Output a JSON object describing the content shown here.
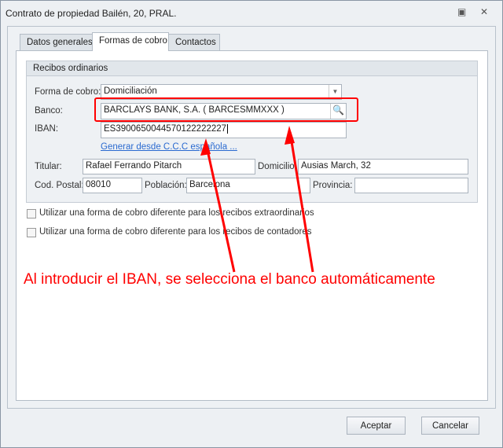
{
  "window": {
    "title": "Contrato de propiedad Bailén, 20, PRAL."
  },
  "tabs": [
    {
      "label": "Datos generales"
    },
    {
      "label": "Formas de cobro"
    },
    {
      "label": "Contactos"
    }
  ],
  "group": {
    "title": "Recibos ordinarios"
  },
  "form": {
    "forma_cobro_label": "Forma de cobro:",
    "forma_cobro_value": "Domiciliación",
    "banco_label": "Banco:",
    "banco_value": "BARCLAYS BANK, S.A. ( BARCESMMXXX )",
    "iban_label": "IBAN:",
    "iban_value": "ES3900650044570122222227",
    "generar_link": "Generar desde C.C.C española ...",
    "titular_label": "Titular:",
    "titular_value": "Rafael Ferrando Pitarch",
    "domicilio_label": "Domicilio:",
    "domicilio_value": "Ausias March, 32",
    "cp_label": "Cod. Postal:",
    "cp_value": "08010",
    "poblacion_label": "Población:",
    "poblacion_value": "Barcelona",
    "provincia_label": "Provincia:",
    "provincia_value": ""
  },
  "checkboxes": [
    {
      "label": "Utilizar una forma de cobro diferente para los recibos extraordinarios",
      "checked": false
    },
    {
      "label": "Utilizar una forma de cobro diferente para los recibos de contadores",
      "checked": false
    }
  ],
  "annotation": "Al introducir el IBAN, se selecciona el banco automáticamente",
  "buttons": {
    "accept": "Aceptar",
    "cancel": "Cancelar"
  },
  "colors": {
    "annotation": "#ff0000",
    "link": "#2a6ad0"
  }
}
